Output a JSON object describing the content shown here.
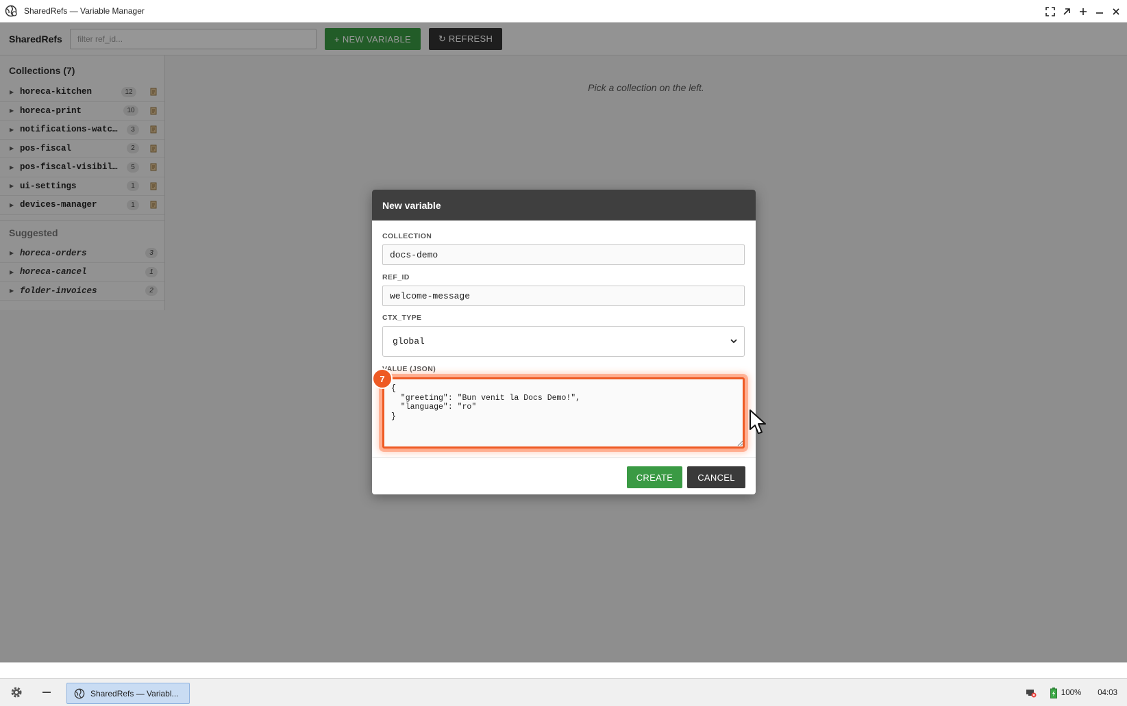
{
  "window": {
    "title": "SharedRefs — Variable Manager"
  },
  "toolbar": {
    "brand": "SharedRefs",
    "filter_placeholder": "filter ref_id...",
    "new_variable_label": "+ NEW VARIABLE",
    "refresh_label": "↻ REFRESH"
  },
  "sidebar": {
    "collections_title": "Collections (7)",
    "collections": [
      {
        "name": "horeca-kitchen",
        "count": "12"
      },
      {
        "name": "horeca-print",
        "count": "10"
      },
      {
        "name": "notifications-watchers",
        "count": "3"
      },
      {
        "name": "pos-fiscal",
        "count": "2"
      },
      {
        "name": "pos-fiscal-visibility",
        "count": "5"
      },
      {
        "name": "ui-settings",
        "count": "1"
      },
      {
        "name": "devices-manager",
        "count": "1"
      }
    ],
    "suggested_title": "Suggested",
    "suggested": [
      {
        "name": "horeca-orders",
        "count": "3"
      },
      {
        "name": "horeca-cancel",
        "count": "1"
      },
      {
        "name": "folder-invoices",
        "count": "2"
      }
    ]
  },
  "main": {
    "empty_message": "Pick a collection on the left."
  },
  "modal": {
    "title": "New variable",
    "collection_label": "COLLECTION",
    "collection_value": "docs-demo",
    "ref_id_label": "REF_ID",
    "ref_id_value": "welcome-message",
    "ctx_type_label": "CTX_TYPE",
    "ctx_type_value": "global",
    "value_label": "VALUE (JSON)",
    "value_json": "{\n  \"greeting\": \"Bun venit la Docs Demo!\",\n  \"language\": \"ro\"\n}",
    "step_badge": "7",
    "create_label": "CREATE",
    "cancel_label": "CANCEL"
  },
  "taskbar": {
    "task_label": "SharedRefs — Variabl...",
    "battery": "100%",
    "clock": "04:03"
  },
  "colors": {
    "accent_green": "#3a9a44",
    "dark_button": "#333333",
    "highlight_orange": "#ee5a24"
  }
}
